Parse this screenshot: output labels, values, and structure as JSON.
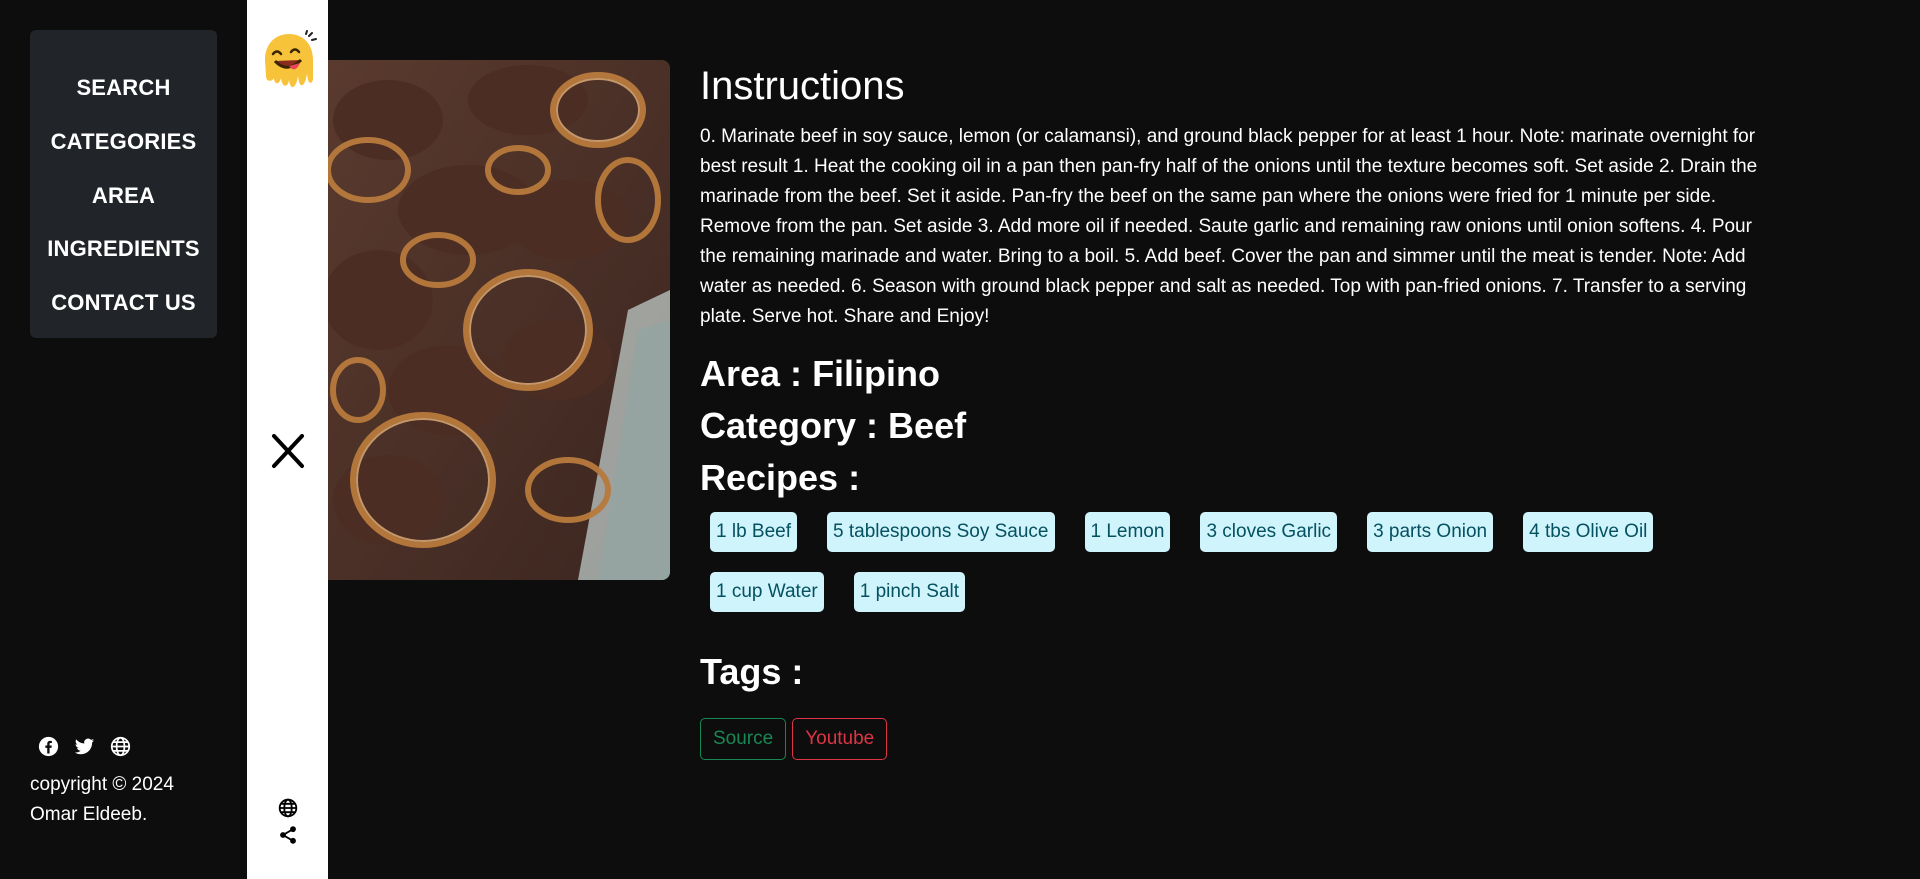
{
  "nav": {
    "items": [
      {
        "label": "SEARCH"
      },
      {
        "label": "CATEGORIES"
      },
      {
        "label": "AREA"
      },
      {
        "label": "INGREDIENTS"
      },
      {
        "label": "CONTACT US"
      }
    ]
  },
  "social": {
    "icons": [
      "facebook-icon",
      "twitter-icon",
      "globe-icon"
    ]
  },
  "footer": {
    "line1": "copyright © 2024",
    "line2": "Omar Eldeeb."
  },
  "meal": {
    "instructions_title": "Instructions",
    "instructions": "0. Marinate beef in soy sauce, lemon (or calamansi), and ground black pepper for at least 1 hour. Note: marinate overnight for best result 1. Heat the cooking oil in a pan then pan-fry half of the onions until the texture becomes soft. Set aside 2. Drain the marinade from the beef. Set it aside. Pan-fry the beef on the same pan where the onions were fried for 1 minute per side. Remove from the pan. Set aside 3. Add more oil if needed. Saute garlic and remaining raw onions until onion softens. 4. Pour the remaining marinade and water. Bring to a boil. 5. Add beef. Cover the pan and simmer until the meat is tender. Note: Add water as needed. 6. Season with ground black pepper and salt as needed. Top with pan-fried onions. 7. Transfer to a serving plate. Serve hot. Share and Enjoy!",
    "area_label": "Area :",
    "area_value": "Filipino",
    "category_label": "Category :",
    "category_value": "Beef",
    "recipes_title": "Recipes :",
    "recipes": [
      "1 lb Beef",
      "5 tablespoons Soy Sauce",
      "1 Lemon",
      "3 cloves Garlic",
      "3 parts Onion",
      "4 tbs Olive Oil",
      "1 cup Water",
      "1 pinch Salt"
    ],
    "tags_title": "Tags :",
    "source_label": "Source",
    "youtube_label": "Youtube"
  },
  "colors": {
    "background": "#0d0d0d",
    "nav_bg": "#212529",
    "chip_bg": "#cff4fc",
    "chip_text": "#055160",
    "source": "#198754",
    "youtube": "#dc3545"
  }
}
